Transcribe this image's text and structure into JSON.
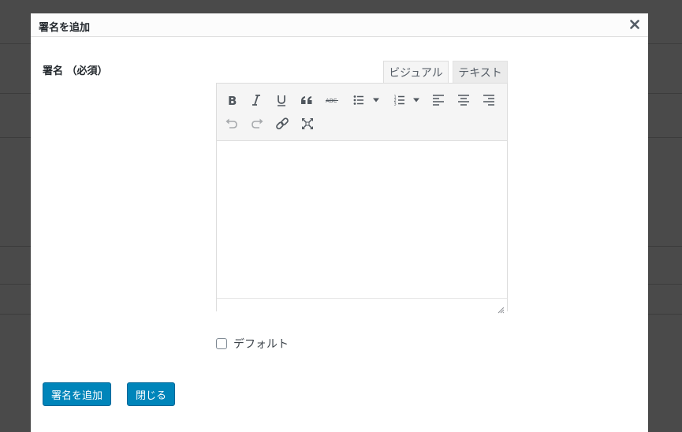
{
  "dialog": {
    "title": "署名を追加",
    "close_icon": "close-icon"
  },
  "form": {
    "signature_label": "署名 （必須）",
    "tabs": [
      {
        "label": "ビジュアル",
        "active": true
      },
      {
        "label": "テキスト",
        "active": false
      }
    ],
    "toolbar_row1": [
      "bold-icon",
      "italic-icon",
      "underline-icon",
      "blockquote-icon",
      "strikethrough-icon",
      "bullet-list-icon",
      "numbered-list-icon",
      "align-left-icon",
      "align-center-icon",
      "align-right-icon"
    ],
    "toolbar_row2": [
      "undo-icon",
      "redo-icon",
      "link-icon",
      "fullscreen-icon"
    ],
    "editor_content": "",
    "default_checkbox": {
      "label": "デフォルト",
      "checked": false
    }
  },
  "buttons": {
    "add_label": "署名を追加",
    "close_label": "閉じる"
  },
  "colors": {
    "primary": "#0085ba",
    "overlay": "#4a4a4a",
    "icon": "#50575e",
    "icon_disabled": "#a7aaad"
  }
}
